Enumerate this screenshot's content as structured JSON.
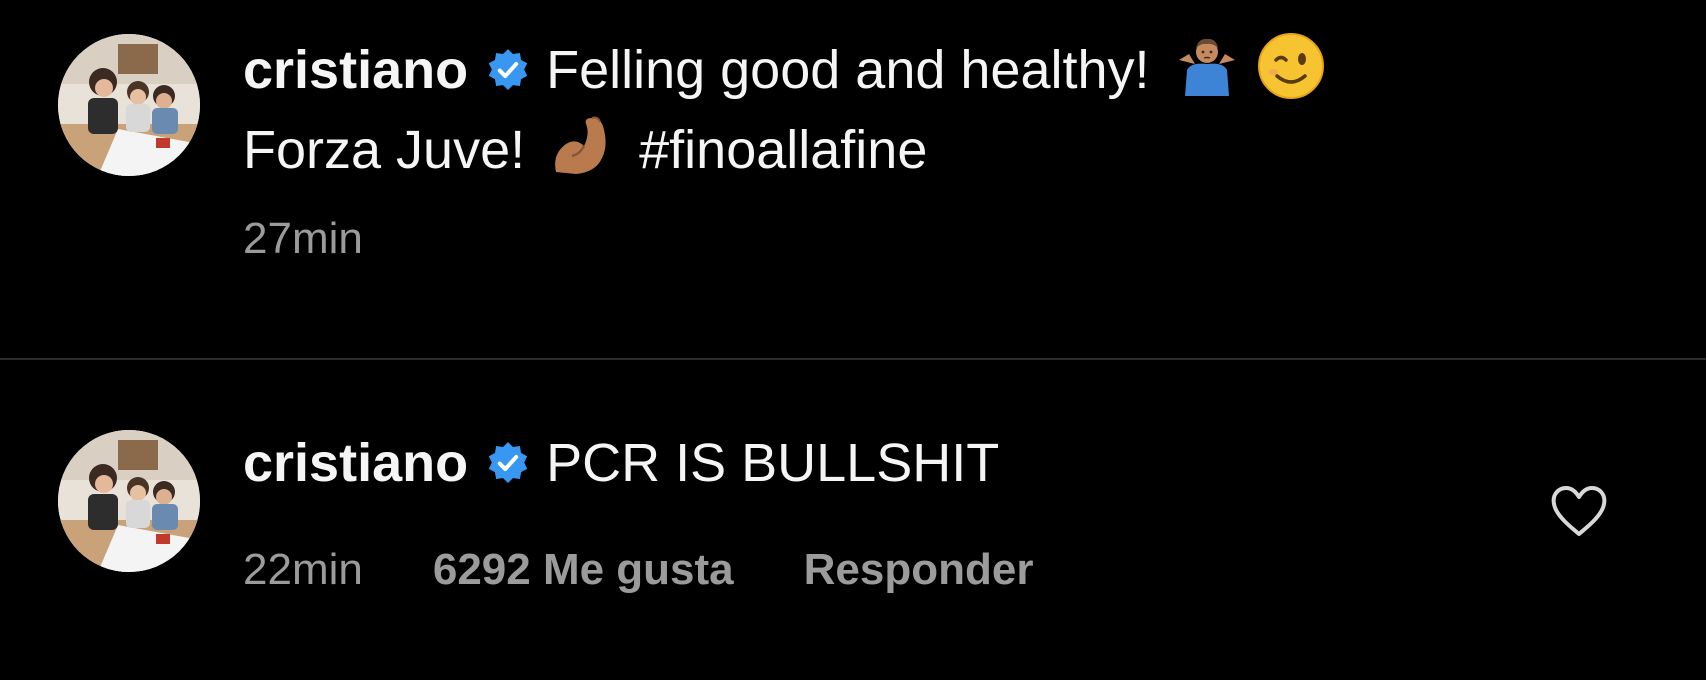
{
  "comments": [
    {
      "username": "cristiano",
      "verified_icon": "verified-badge-icon",
      "text_part1": "Felling good and healthy!",
      "emoji_1": "person-shrugging-emoji",
      "emoji_2": "winking-face-emoji",
      "text_part2": "Forza Juve!",
      "emoji_3": "flexed-biceps-emoji",
      "hashtag": "#finoallafine",
      "time": "27min"
    },
    {
      "username": "cristiano",
      "verified_icon": "verified-badge-icon",
      "text": "PCR IS BULLSHIT",
      "time": "22min",
      "likes": "6292 Me gusta",
      "reply": "Responder",
      "like_icon": "heart-outline-icon"
    }
  ],
  "colors": {
    "background": "#000000",
    "text": "#f5f5f5",
    "secondary_text": "#9b9b9b",
    "verified_blue": "#3897f0",
    "divider": "#2a2a2a"
  }
}
